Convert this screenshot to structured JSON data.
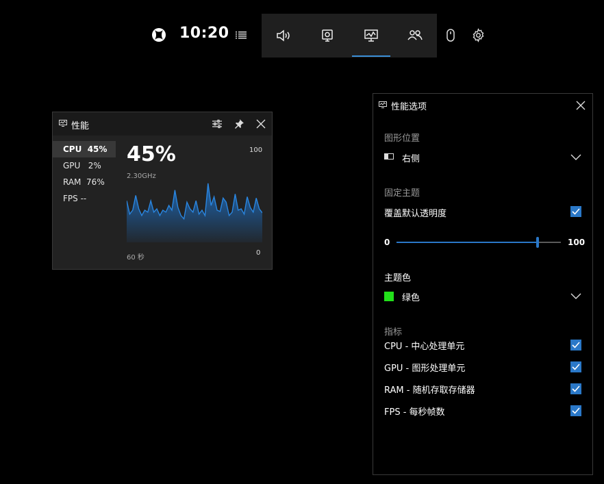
{
  "topbar": {
    "time": "10:20",
    "icons": [
      "xbox-logo-icon",
      "widget-menu-icon",
      "audio-icon",
      "capture-icon",
      "performance-icon",
      "social-icon",
      "mouse-icon",
      "settings-icon"
    ],
    "active_tab": "performance"
  },
  "perf": {
    "title": "性能",
    "metrics": [
      {
        "label": "CPU  45%",
        "selected": true
      },
      {
        "label": "GPU   2%",
        "selected": false
      },
      {
        "label": "RAM  76%",
        "selected": false
      },
      {
        "label": "FPS --",
        "selected": false
      }
    ],
    "big_value": "45%",
    "frequency": "2.30GHz",
    "y_max": "100",
    "y_min": "0",
    "x_span": "60 秒",
    "chart_data": {
      "type": "area",
      "ylim": [
        0,
        100
      ],
      "values": [
        62,
        42,
        48,
        70,
        50,
        40,
        48,
        45,
        62,
        45,
        50,
        40,
        48,
        45,
        55,
        48,
        78,
        52,
        40,
        35,
        60,
        50,
        45,
        62,
        42,
        48,
        40,
        88,
        55,
        68,
        48,
        46,
        66,
        60,
        40,
        45,
        72,
        48,
        50,
        42,
        68,
        52,
        45,
        66,
        50,
        44
      ]
    }
  },
  "options": {
    "title": "性能选项",
    "position_section": "图形位置",
    "position_value": "右侧",
    "pin_section": "固定主题",
    "override_label": "覆盖默认透明度",
    "override_checked": true,
    "slider_min": "0",
    "slider_max": "100",
    "slider_value": 86,
    "accent_section": "主题色",
    "accent_value": "绿色",
    "accent_color": "#22e01a",
    "metrics_section": "指标",
    "metric_items": [
      {
        "label": "CPU - 中心处理单元",
        "checked": true
      },
      {
        "label": "GPU - 图形处理单元",
        "checked": true
      },
      {
        "label": "RAM - 随机存取存储器",
        "checked": true
      },
      {
        "label": "FPS - 每秒帧数",
        "checked": true
      }
    ]
  }
}
